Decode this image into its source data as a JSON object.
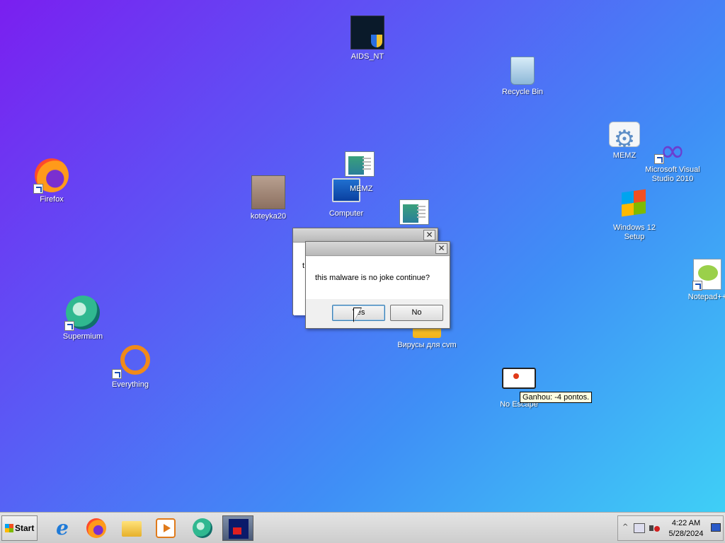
{
  "desktop": {
    "icons": {
      "aids_nt": "AIDS_NT",
      "recycle_bin": "Recycle Bin",
      "firefox": "Firefox",
      "koteyka": "koteyka20",
      "memz_window": "MEMZ",
      "computer": "Computer",
      "memz": "MEMZ",
      "visual_studio": "Microsoft Visual Studio 2010",
      "windows12": "Windows 12 Setup",
      "notepad": "Notepad++",
      "supermium": "Supermium",
      "everything": "Everything",
      "viruses_folder": "Вирусы для cvm",
      "no_escape": "No Escape"
    },
    "tooltip": "Ganhou: -4 pontos."
  },
  "dialog_back": {
    "message_fragment": "t"
  },
  "dialog": {
    "message": "this malware is no joke continue?",
    "yes_label": "Yes",
    "no_label": "No",
    "close_glyph": "✕"
  },
  "taskbar": {
    "start_label": "Start",
    "apps": [
      "internet-explorer",
      "firefox",
      "file-explorer",
      "media-player",
      "supermium",
      "memz"
    ],
    "clock_time": "4:22 AM",
    "clock_date": "5/28/2024",
    "tray_expand_glyph": "^"
  },
  "colors": {
    "wallpaper_start": "#7a1ff0",
    "wallpaper_end": "#3fd4f6",
    "taskbar": "#d6d6d6"
  }
}
